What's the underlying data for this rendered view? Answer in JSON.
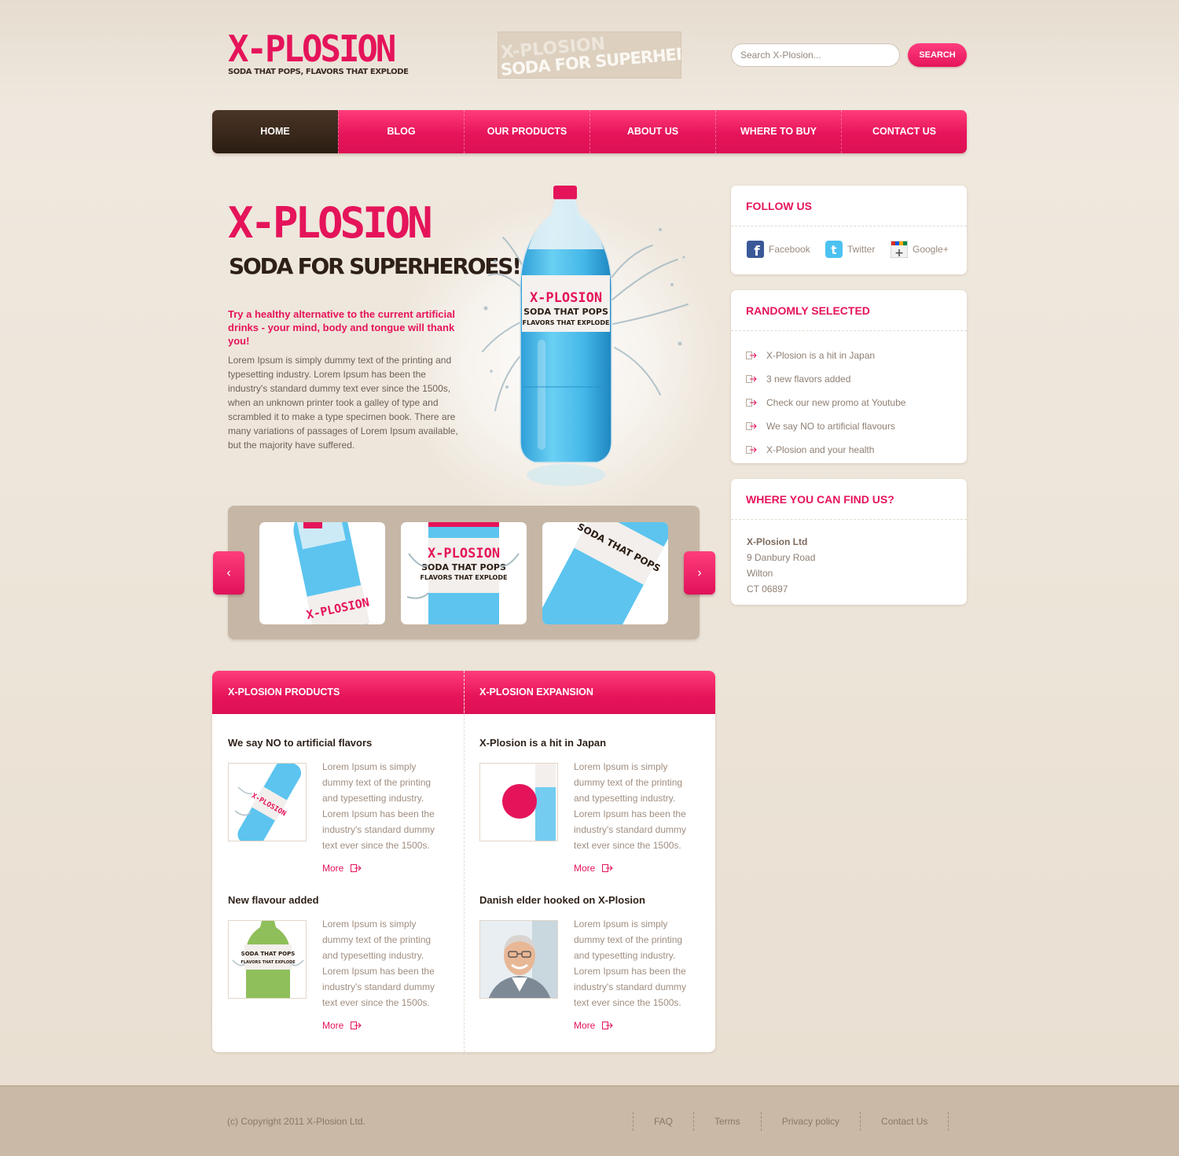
{
  "brand": {
    "logo_title": "X-PLOSION",
    "logo_tagline": "SODA THAT POPS, FLAVORS THAT EXPLODE",
    "stamp_line1": "X-PLOSION",
    "stamp_line2": "SODA FOR SUPERHEROES"
  },
  "search": {
    "placeholder": "Search X-Plosion...",
    "button_label": "SEARCH"
  },
  "nav": {
    "items": [
      "HOME",
      "BLOG",
      "OUR PRODUCTS",
      "ABOUT US",
      "WHERE TO BUY",
      "CONTACT US"
    ],
    "active": "HOME"
  },
  "hero": {
    "title": "X-PLOSION",
    "subtitle": "SODA FOR SUPERHEROES!",
    "lead": "Try a healthy alternative to the current artificial drinks - your mind, body and tongue will thank you!",
    "body": "Lorem Ipsum is simply dummy text of the printing and typesetting industry. Lorem Ipsum has been the industry's standard dummy text ever since the 1500s, when an unknown printer took a galley of type and scrambled it to make a type specimen book. There are many variations of passages of Lorem Ipsum available, but the majority have suffered.",
    "bottle_label_title": "X-PLOSION",
    "bottle_label_line1": "SODA THAT POPS",
    "bottle_label_line2": "FLAVORS THAT EXPLODE"
  },
  "slider": {
    "prev_icon": "chevron-left-icon",
    "next_icon": "chevron-right-icon",
    "prev_glyph": "‹",
    "next_glyph": "›"
  },
  "sidebar": {
    "follow": {
      "title": "FOLLOW US",
      "links": [
        {
          "label": "Facebook",
          "icon": "facebook-icon"
        },
        {
          "label": "Twitter",
          "icon": "twitter-icon"
        },
        {
          "label": "Google+",
          "icon": "google-plus-icon"
        }
      ]
    },
    "random": {
      "title": "RANDOMLY SELECTED",
      "items": [
        "X-Plosion is a hit in Japan",
        "3 new flavors added",
        "Check our new promo at Youtube",
        "We say NO to artificial flavours",
        "X-Plosion and your health"
      ]
    },
    "find": {
      "title": "WHERE YOU CAN FIND US?",
      "company": "X-Plosion Ltd",
      "street": "9 Danbury Road",
      "city": "Wilton",
      "postcode": "CT 06897"
    }
  },
  "news": {
    "left_title": "X-PLOSION PRODUCTS",
    "right_title": "X-PLOSION EXPANSION",
    "more_label": "More",
    "articles": [
      {
        "title": "We say NO to artificial flavors",
        "text": "Lorem Ipsum is simply dummy text of the printing and typesetting industry. Lorem Ipsum has been the industry's standard dummy text ever since the 1500s."
      },
      {
        "title": "X-Plosion is a hit in Japan",
        "text": "Lorem Ipsum is simply dummy text of the printing and typesetting industry. Lorem Ipsum has been the industry's standard dummy text ever since the 1500s."
      },
      {
        "title": "New flavour added",
        "text": "Lorem Ipsum is simply dummy text of the printing and typesetting industry. Lorem Ipsum has been the industry's standard dummy text ever since the 1500s."
      },
      {
        "title": "Danish elder hooked on X-Plosion",
        "text": "Lorem Ipsum is simply dummy text of the printing and typesetting industry. Lorem Ipsum has been the industry's standard dummy text ever since the 1500s."
      }
    ]
  },
  "footer": {
    "copyright": "(c) Copyright 2011 X-Plosion Ltd.",
    "links": [
      "FAQ",
      "Terms",
      "Privacy policy",
      "Contact Us"
    ]
  },
  "colors": {
    "accent": "#e5145a",
    "nav_active": "#2b1d12",
    "soda_blue": "#3cb6e6",
    "background": "#ede5d9"
  }
}
